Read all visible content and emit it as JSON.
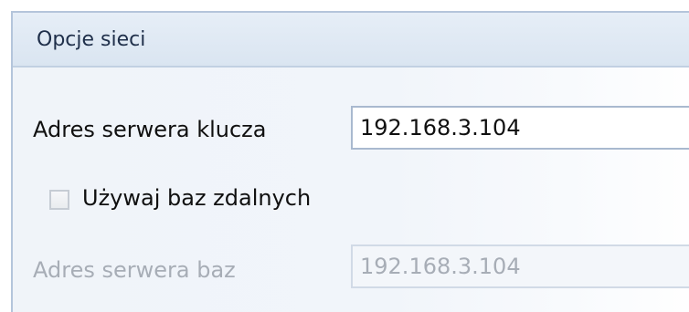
{
  "panel": {
    "title": "Opcje sieci"
  },
  "key_server": {
    "label": "Adres serwera klucza",
    "value": "192.168.3.104"
  },
  "remote_db": {
    "label": "Używaj baz zdalnych",
    "checked": false
  },
  "db_server": {
    "label": "Adres serwera baz",
    "value": "192.168.3.104",
    "enabled": false
  }
}
